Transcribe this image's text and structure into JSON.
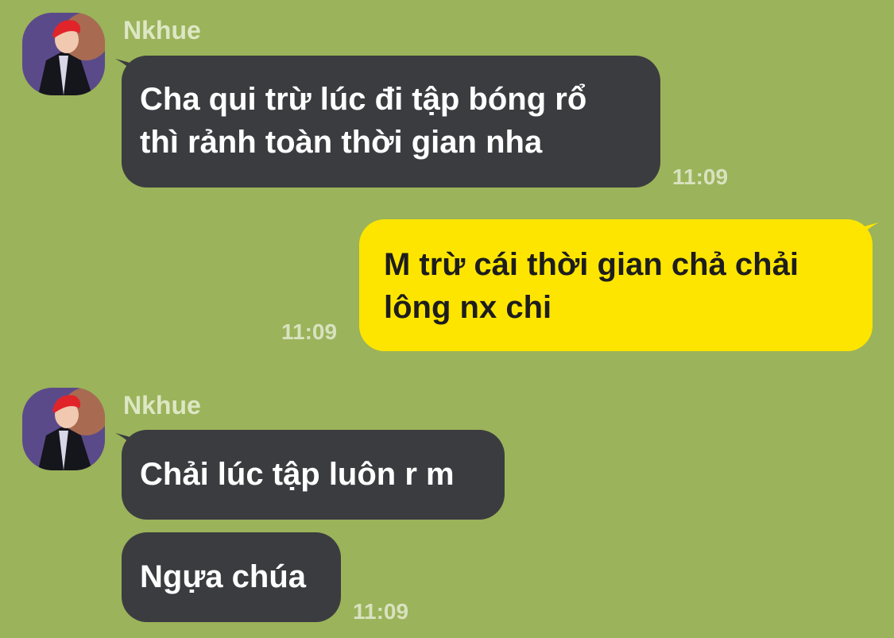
{
  "contact": {
    "name": "Nkhue"
  },
  "messages": [
    {
      "from": "Nkhue",
      "lines": [
        "Cha qui trừ lúc đi tập bóng rổ",
        "thì rảnh toàn thời gian nha"
      ],
      "time": "11:09"
    },
    {
      "from": "me",
      "lines": [
        "M trừ cái thời gian chả chải",
        "lông nx chi"
      ],
      "time": "11:09"
    },
    {
      "from": "Nkhue",
      "lines": [
        "Chải lúc tập luôn r m"
      ]
    },
    {
      "from": "Nkhue",
      "lines": [
        "Ngựa chúa"
      ],
      "time": "11:09"
    }
  ],
  "colors": {
    "background": "#9bb35a",
    "incoming_bubble": "#3b3c40",
    "outgoing_bubble": "#fee500"
  }
}
